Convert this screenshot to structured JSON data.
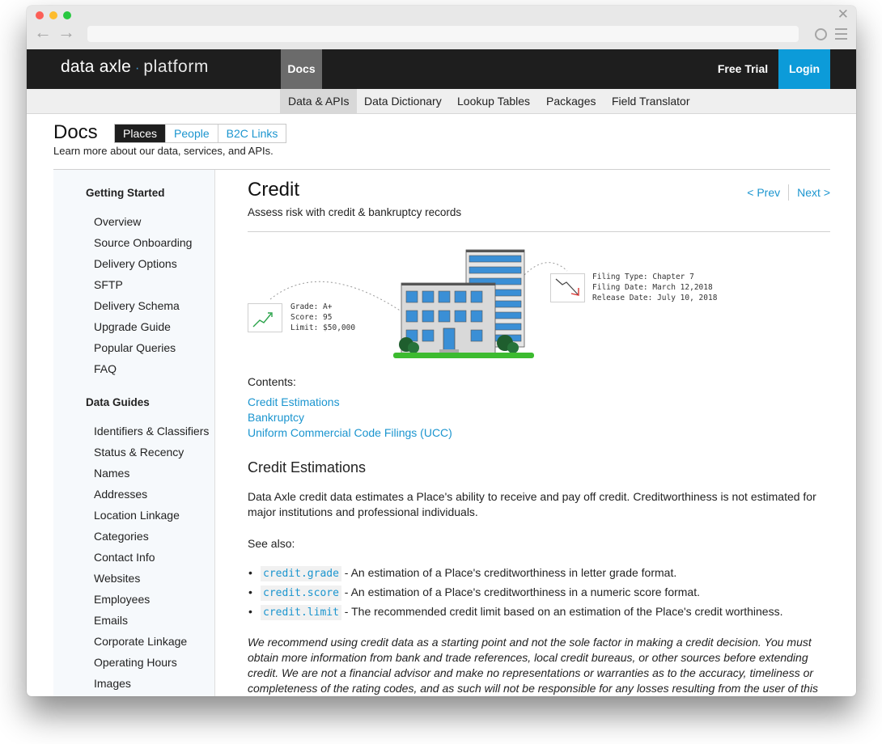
{
  "brand": {
    "part1": "data axle",
    "separator": "·",
    "part2": "platform"
  },
  "topnav": {
    "docs": "Docs",
    "free_trial": "Free Trial",
    "login": "Login"
  },
  "subnav": [
    "Data & APIs",
    "Data Dictionary",
    "Lookup Tables",
    "Packages",
    "Field Translator"
  ],
  "header": {
    "title": "Docs",
    "tabs": [
      "Places",
      "People",
      "B2C Links"
    ],
    "subtitle": "Learn more about our data, services, and APIs."
  },
  "sidebar": {
    "getting_started": {
      "heading": "Getting Started",
      "items": [
        "Overview",
        "Source Onboarding",
        "Delivery Options",
        "SFTP",
        "Delivery Schema",
        "Upgrade Guide",
        "Popular Queries",
        "FAQ"
      ]
    },
    "data_guides": {
      "heading": "Data Guides",
      "items": [
        "Identifiers & Classifiers",
        "Status & Recency",
        "Names",
        "Addresses",
        "Location Linkage",
        "Categories",
        "Contact Info",
        "Websites",
        "Employees",
        "Emails",
        "Corporate Linkage",
        "Operating Hours",
        "Images"
      ]
    }
  },
  "content": {
    "title": "Credit",
    "subtitle": "Assess risk with credit & bankruptcy records",
    "pager": {
      "prev": "< Prev",
      "next": "Next >"
    },
    "illustration": {
      "left_card": [
        "Grade: A+",
        "Score: 95",
        "Limit: $50,000"
      ],
      "right_card": [
        "Filing Type: Chapter 7",
        "Filing Date: March 12,2018",
        "Release Date: July 10, 2018"
      ]
    },
    "contents_label": "Contents:",
    "toc": [
      "Credit Estimations",
      "Bankruptcy",
      "Uniform Commercial Code Filings (UCC)"
    ],
    "section_title": "Credit Estimations",
    "intro": "Data Axle credit data estimates a Place's ability to receive and pay off credit. Creditworthiness is not estimated for major institutions and professional individuals.",
    "see_also": "See also:",
    "bullets": [
      {
        "code": "credit.grade",
        "text": " - An estimation of a Place's creditworthiness in letter grade format."
      },
      {
        "code": "credit.score",
        "text": " - An estimation of a Place's creditworthiness in a numeric score format."
      },
      {
        "code": "credit.limit",
        "text": " - The recommended credit limit based on an estimation of the Place's credit worthiness."
      }
    ],
    "disclaimer": "We recommend using credit data as a starting point and not the sole factor in making a credit decision. You must obtain more information from bank and trade references, local credit bureaus, or other sources before extending credit. We are not a financial advisor and make no representations or warranties as to the accuracy, timeliness or completeness of the rating codes, and as such will not be responsible for any losses resulting from the user of this"
  },
  "colors": {
    "link": "#1b95cf",
    "login_bg": "#0c9bd9",
    "topbar": "#1e1e1e"
  }
}
